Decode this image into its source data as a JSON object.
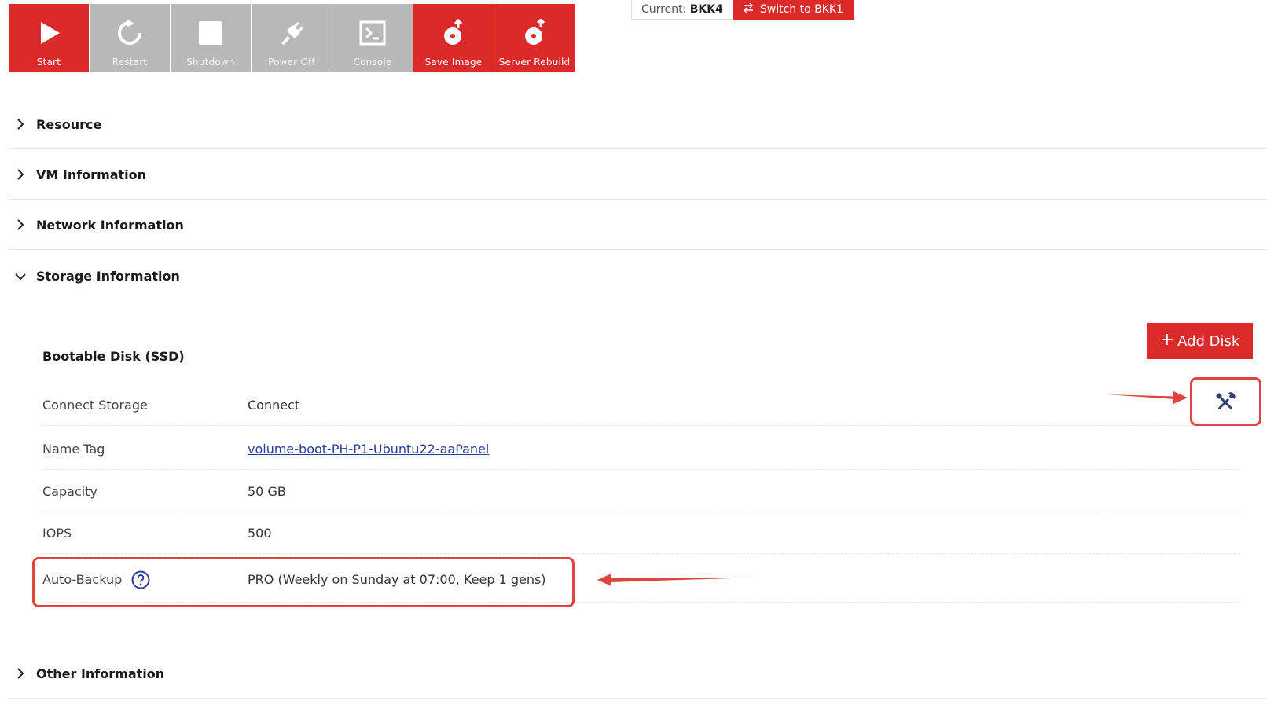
{
  "toolbar": {
    "buttons": [
      {
        "label": "Start",
        "icon": "play-icon",
        "state": "active"
      },
      {
        "label": "Restart",
        "icon": "restart-icon",
        "state": "disabled"
      },
      {
        "label": "Shutdown",
        "icon": "stop-icon",
        "state": "disabled"
      },
      {
        "label": "Power Off",
        "icon": "plug-icon",
        "state": "disabled"
      },
      {
        "label": "Console",
        "icon": "terminal-icon",
        "state": "disabled"
      },
      {
        "label": "Save Image",
        "icon": "disk-save-icon",
        "state": "active"
      },
      {
        "label": "Server Rebuild",
        "icon": "disk-rebuild-icon",
        "state": "active"
      }
    ]
  },
  "region": {
    "current_prefix": "Current:",
    "current_value": "BKK4",
    "switch_label": "Switch to BKK1"
  },
  "sections": {
    "resource": "Resource",
    "vm_information": "VM Information",
    "network_information": "Network Information",
    "storage_information": "Storage Information",
    "other_information": "Other Information"
  },
  "storage": {
    "add_disk_plus": "+",
    "add_disk_label": "Add Disk",
    "disk_title": "Bootable Disk (SSD)",
    "rows": {
      "connect": {
        "key": "Connect Storage",
        "value": "Connect"
      },
      "name_tag": {
        "key": "Name Tag",
        "value": "volume-boot-PH-P1-Ubuntu22-aaPanel"
      },
      "capacity": {
        "key": "Capacity",
        "value": "50 GB"
      },
      "iops": {
        "key": "IOPS",
        "value": "500"
      },
      "auto_backup": {
        "key": "Auto-Backup",
        "value": "PRO (Weekly on Sunday at 07:00, Keep 1 gens)"
      }
    }
  },
  "colors": {
    "accent": "#dc2a2a",
    "disabled": "#b9b9b9",
    "annotation": "#e0443e",
    "link": "#2a3f97"
  }
}
